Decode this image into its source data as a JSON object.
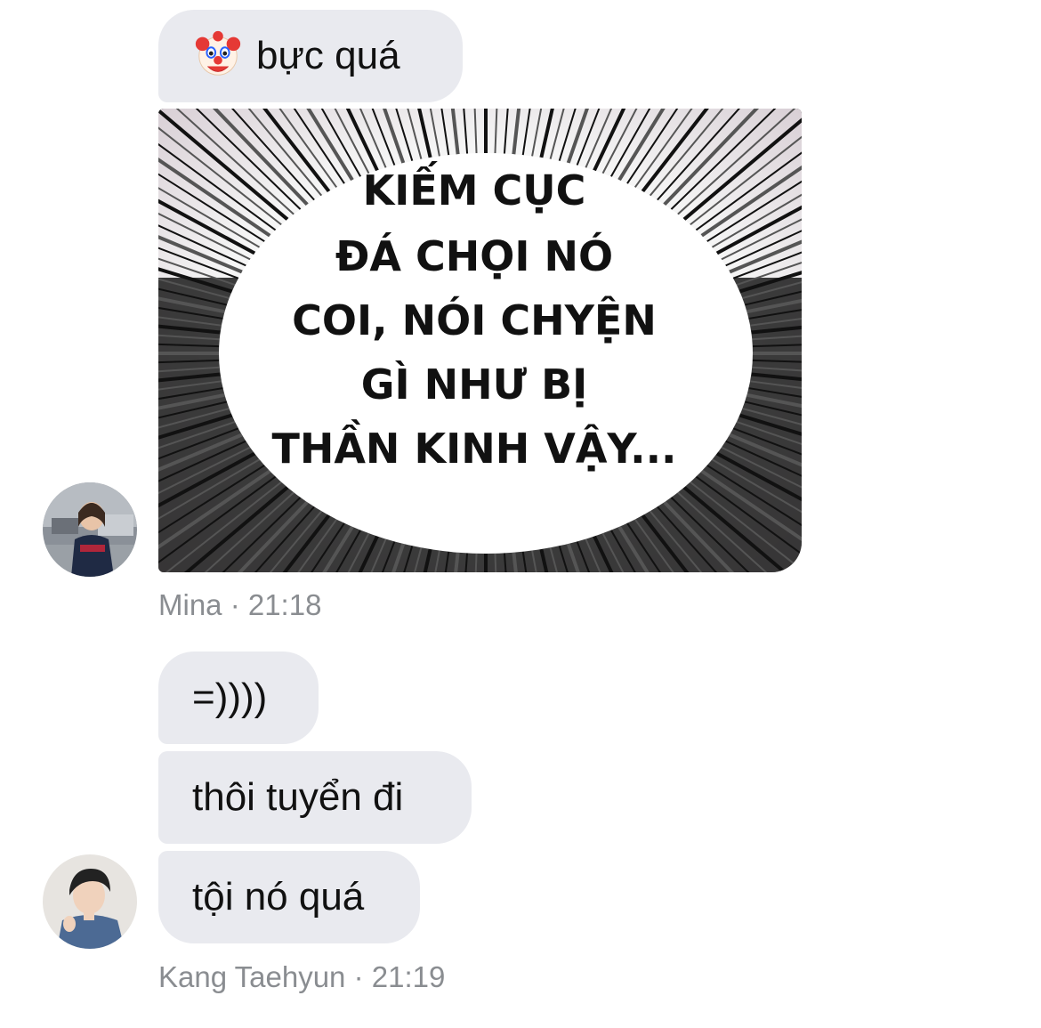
{
  "messages": [
    {
      "sender": "Mina",
      "time": "21:18",
      "meta_text": "Mina  · 21:18",
      "bubbles": [
        {
          "icon": "clown-face-icon",
          "text": "bực quá"
        }
      ],
      "image": {
        "lines": [
          "KIẾM CỤC",
          "ĐÁ CHỌI NÓ",
          "COI, NÓI CHYỆN",
          "GÌ NHƯ BỊ",
          "THẦN KINH VẬY..."
        ]
      }
    },
    {
      "sender": "Kang Taehyun",
      "time": "21:19",
      "meta_text": "Kang Taehyun · 21:19",
      "bubbles": [
        {
          "text": "=))))"
        },
        {
          "text": "thôi tuyển đi"
        },
        {
          "text": "tội nó quá"
        }
      ]
    }
  ],
  "colors": {
    "bubble_bg": "#e9eaef",
    "meta_text": "#8a8d91",
    "background": "#ffffff"
  }
}
